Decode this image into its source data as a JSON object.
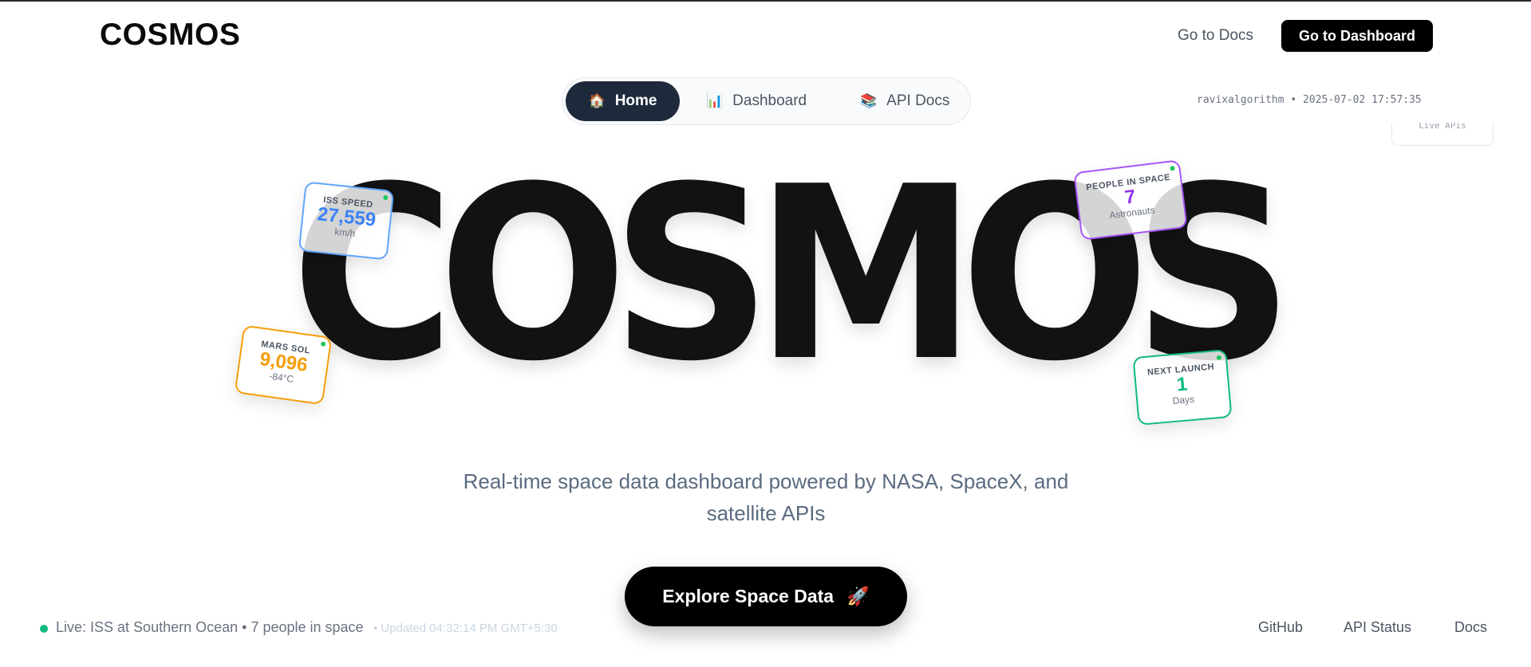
{
  "header": {
    "logo": "COSMOS",
    "docs_link": "Go to Docs",
    "dashboard_button": "Go to Dashboard"
  },
  "nav": {
    "items": [
      {
        "icon": "🏠",
        "icon_name": "house-icon",
        "label": "Home",
        "active": true
      },
      {
        "icon": "📊",
        "icon_name": "bar-chart-icon",
        "label": "Dashboard",
        "active": false
      },
      {
        "icon": "📚",
        "icon_name": "books-icon",
        "label": "API Docs",
        "active": false
      }
    ]
  },
  "session": "ravixalgorithm • 2025-07-02 17:57:35",
  "live_apis": "Live APIs",
  "hero": {
    "title": "COSMOS",
    "subtitle": "Real-time space data dashboard powered by NASA, SpaceX, and satellite APIs",
    "cta": "Explore Space Data",
    "cta_icon": "🚀"
  },
  "cards": {
    "iss": {
      "label": "ISS SPEED",
      "value": "27,559",
      "unit": "km/h",
      "color": "#3b82f6"
    },
    "people": {
      "label": "PEOPLE IN SPACE",
      "value": "7",
      "unit": "Astronauts",
      "color": "#9333ea"
    },
    "mars": {
      "label": "MARS SOL",
      "value": "9,096",
      "unit": "-84°C",
      "color": "#f59e0b"
    },
    "launch": {
      "label": "NEXT LAUNCH",
      "value": "1",
      "unit": "Days",
      "color": "#10b981"
    }
  },
  "footer": {
    "status": "Live: ISS at Southern Ocean • 7 people in space",
    "updated": "• Updated 04:32:14 PM GMT+5:30",
    "links": [
      "GitHub",
      "API Status",
      "Docs"
    ]
  },
  "colors": {
    "accent": "#000000",
    "nav_active": "#1e293b",
    "live": "#10b981"
  }
}
